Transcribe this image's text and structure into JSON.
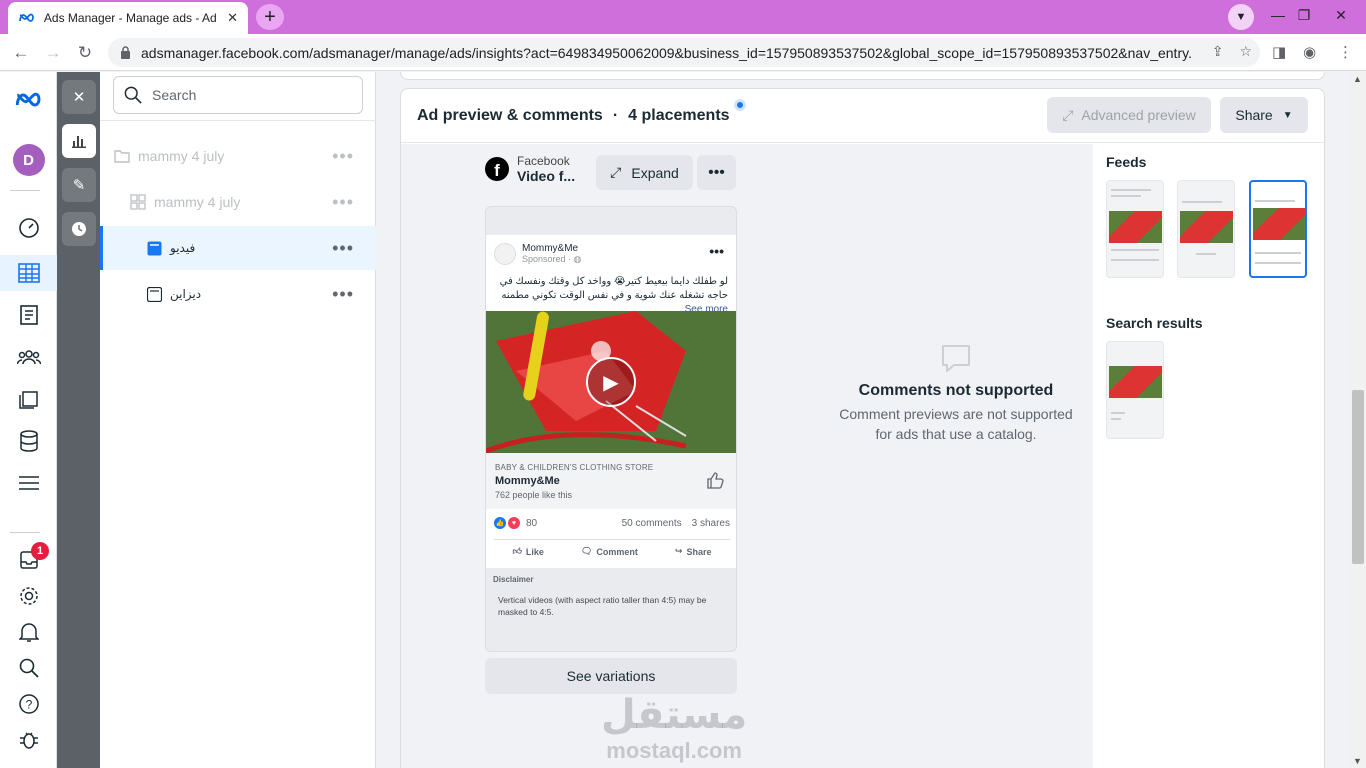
{
  "browser": {
    "tab_title": "Ads Manager - Manage ads - Ad",
    "url": "adsmanager.facebook.com/adsmanager/manage/ads/insights?act=649834950062009&business_id=157950893537502&global_scope_id=157950893537502&nav_entry...",
    "colors": {
      "tabbar": "#cf6fdc"
    }
  },
  "rail": {
    "avatar_letter": "D",
    "notification_count": "1"
  },
  "tree": {
    "search_placeholder": "Search",
    "items": [
      {
        "label": "mammy 4 july",
        "level": "campaign",
        "icon": "folder-icon"
      },
      {
        "label": "mammy 4 july",
        "level": "ad-set",
        "icon": "grid-icon"
      },
      {
        "label": "فيديو",
        "level": "ad",
        "icon": "ad-icon",
        "selected": true
      },
      {
        "label": "ديزاين",
        "level": "ad",
        "icon": "ad-icon"
      }
    ]
  },
  "panel": {
    "title": "Ad preview & comments",
    "placements": "4 placements",
    "advanced_preview": "Advanced preview",
    "share": "Share"
  },
  "preview": {
    "platform": "Facebook",
    "placement": "Video f...",
    "expand": "Expand",
    "ad": {
      "page_name": "Mommy&Me",
      "sponsored": "Sponsored · ",
      "text": "لو طفلك دايما بيعيط كتير😭 وواخد كل وقتك ونفسك في حاجه تشغله عنك شوية و في نفس الوقت تكوني مطمنه",
      "see_more": "See more...",
      "category": "BABY & CHILDREN'S CLOTHING STORE",
      "brand": "Mommy&Me",
      "page_likes": "762 people like this",
      "reactions_count": "80",
      "comments": "50 comments",
      "shares": "3 shares",
      "like": "Like",
      "comment": "Comment",
      "share": "Share"
    },
    "disclaimer_title": "Disclaimer",
    "disclaimer_body": "Vertical videos (with aspect ratio taller than 4:5) may be masked to 4:5.",
    "see_variations": "See variations"
  },
  "comments": {
    "title": "Comments not supported",
    "body": "Comment previews are not supported for ads that use a catalog."
  },
  "side": {
    "feeds": "Feeds",
    "search_results": "Search results"
  },
  "watermark": {
    "arabic": "مستقل",
    "latin": "mostaql.com"
  }
}
